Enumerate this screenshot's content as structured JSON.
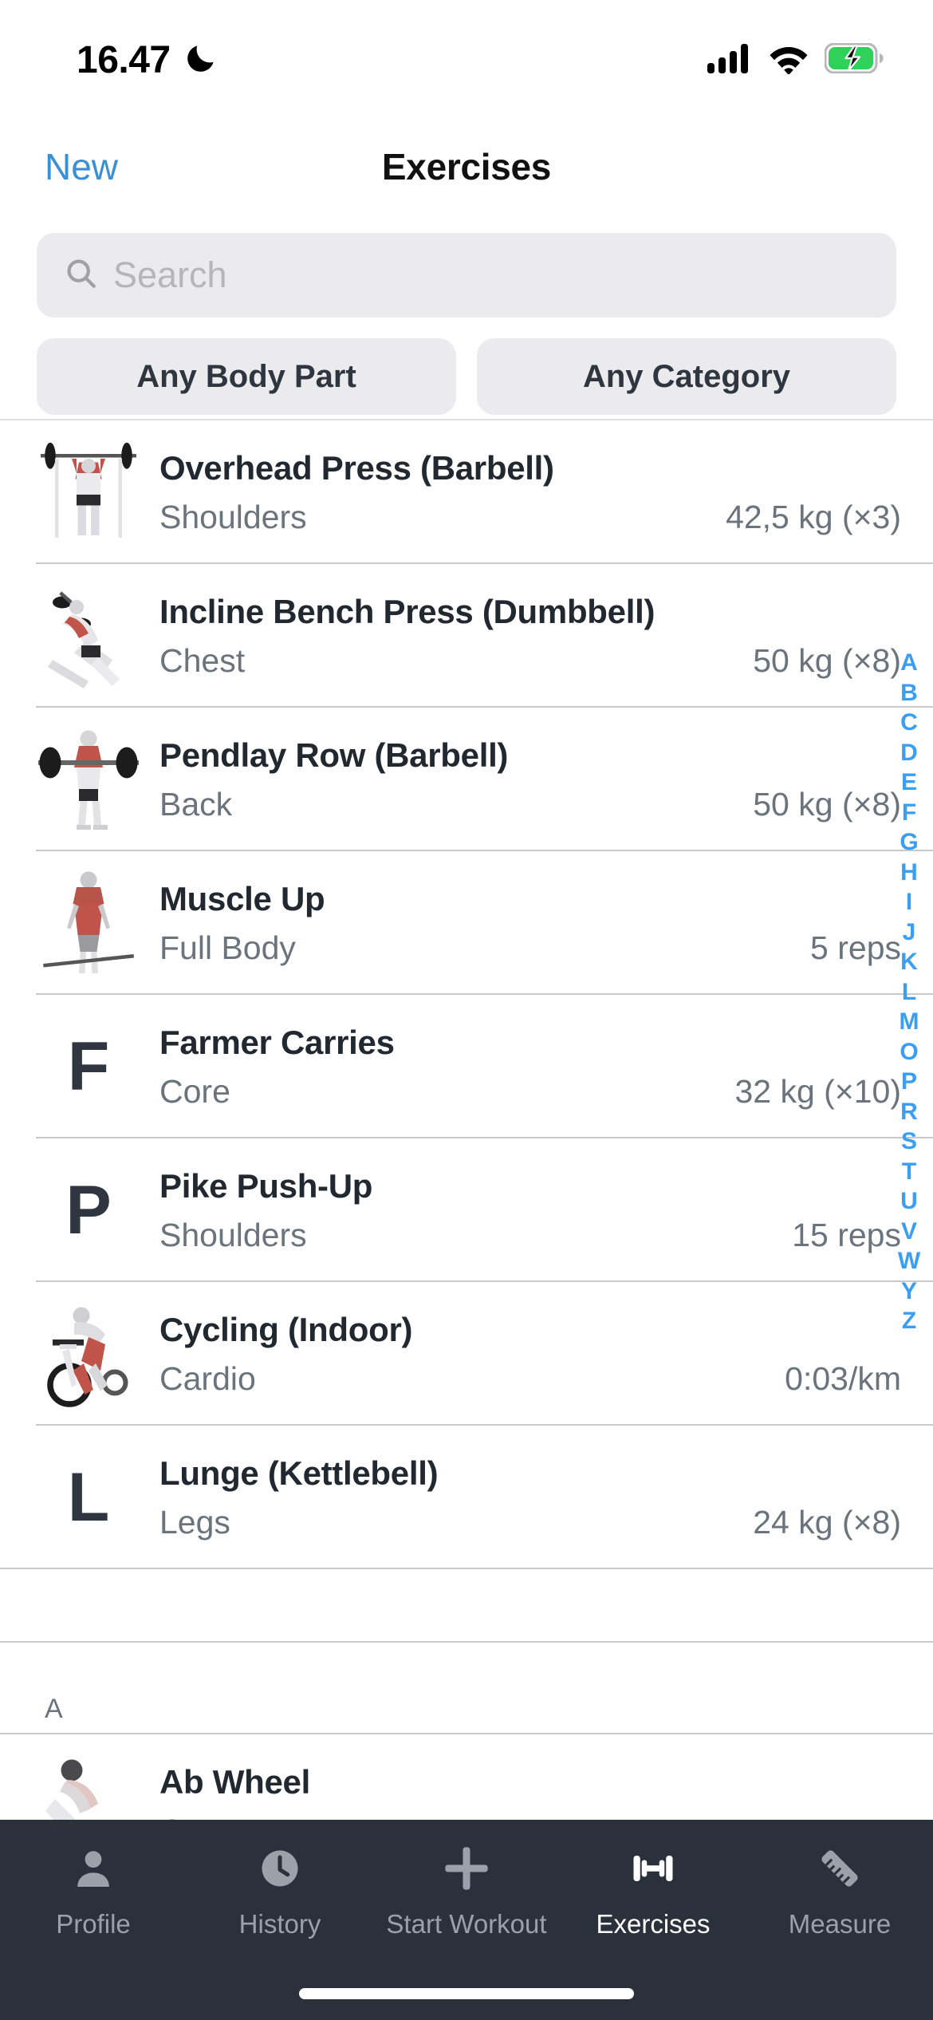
{
  "status_bar": {
    "time": "16.47",
    "dnd_icon": "crescent-moon-icon",
    "cellular_icon": "cellular-signal-icon",
    "wifi_icon": "wifi-icon",
    "battery_icon": "battery-charging-icon",
    "battery_color": "#30d158"
  },
  "nav": {
    "left_action": "New",
    "title": "Exercises",
    "accent_color": "#3b8fd4"
  },
  "search": {
    "placeholder": "Search",
    "icon": "search-icon"
  },
  "filters": [
    {
      "label": "Any Body Part"
    },
    {
      "label": "Any Category"
    }
  ],
  "list": {
    "rows": [
      {
        "title": "Overhead Press (Barbell)",
        "subtitle": "Shoulders",
        "value": "42,5 kg (×3)",
        "thumb": "image",
        "art": "overhead-press"
      },
      {
        "title": "Incline Bench Press (Dumbbell)",
        "subtitle": "Chest",
        "value": "50 kg (×8)",
        "thumb": "image",
        "art": "incline-bench"
      },
      {
        "title": "Pendlay Row (Barbell)",
        "subtitle": "Back",
        "value": "50 kg (×8)",
        "thumb": "image",
        "art": "pendlay-row"
      },
      {
        "title": "Muscle Up",
        "subtitle": "Full Body",
        "value": "5 reps",
        "thumb": "image",
        "art": "muscle-up"
      },
      {
        "title": "Farmer Carries",
        "subtitle": "Core",
        "value": "32 kg (×10)",
        "thumb": "letter",
        "letter": "F"
      },
      {
        "title": "Pike Push-Up",
        "subtitle": "Shoulders",
        "value": "15 reps",
        "thumb": "letter",
        "letter": "P"
      },
      {
        "title": "Cycling (Indoor)",
        "subtitle": "Cardio",
        "value": "0:03/km",
        "thumb": "image",
        "art": "cycling"
      },
      {
        "title": "Lunge (Kettlebell)",
        "subtitle": "Legs",
        "value": "24 kg (×8)",
        "thumb": "letter",
        "letter": "L"
      }
    ],
    "section_header": "A",
    "section_rows": [
      {
        "title": "Ab Wheel",
        "subtitle": "Core",
        "value": "",
        "thumb": "image",
        "art": "ab-wheel"
      }
    ]
  },
  "index": {
    "letters": [
      "A",
      "B",
      "C",
      "D",
      "E",
      "F",
      "G",
      "H",
      "I",
      "J",
      "K",
      "L",
      "M",
      "O",
      "P",
      "R",
      "S",
      "T",
      "U",
      "V",
      "W",
      "Y",
      "Z"
    ],
    "color": "#3b9ef2"
  },
  "tab_bar": {
    "background": "#2a313a",
    "inactive_color": "#9ba1a8",
    "active_color": "#ffffff",
    "tabs": [
      {
        "label": "Profile",
        "icon": "person-icon",
        "active": false
      },
      {
        "label": "History",
        "icon": "clock-icon",
        "active": false
      },
      {
        "label": "Start Workout",
        "icon": "plus-icon",
        "active": false
      },
      {
        "label": "Exercises",
        "icon": "dumbbell-icon",
        "active": true
      },
      {
        "label": "Measure",
        "icon": "ruler-icon",
        "active": false
      }
    ]
  }
}
